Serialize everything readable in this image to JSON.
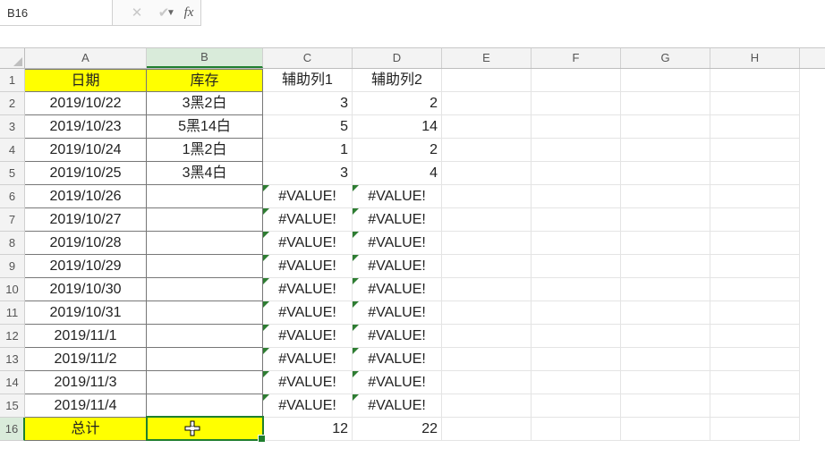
{
  "formula_bar": {
    "name_box_value": "B16",
    "fx_label": "fx",
    "formula_value": ""
  },
  "columns": [
    "A",
    "B",
    "C",
    "D",
    "E",
    "F",
    "G",
    "H"
  ],
  "selected_col_index": 1,
  "selected_row_index": 15,
  "header_row": {
    "A": "日期",
    "B": "库存",
    "C": "辅助列1",
    "D": "辅助列2"
  },
  "rows": [
    {
      "n": 1,
      "A": "日期",
      "B": "库存",
      "C": "辅助列1",
      "D": "辅助列2",
      "hdr": true
    },
    {
      "n": 2,
      "A": "2019/10/22",
      "B": "3黑2白",
      "C": "3",
      "D": "2"
    },
    {
      "n": 3,
      "A": "2019/10/23",
      "B": "5黑14白",
      "C": "5",
      "D": "14"
    },
    {
      "n": 4,
      "A": "2019/10/24",
      "B": "1黑2白",
      "C": "1",
      "D": "2"
    },
    {
      "n": 5,
      "A": "2019/10/25",
      "B": "3黑4白",
      "C": "3",
      "D": "4"
    },
    {
      "n": 6,
      "A": "2019/10/26",
      "B": "",
      "C": "#VALUE!",
      "D": "#VALUE!",
      "err": true
    },
    {
      "n": 7,
      "A": "2019/10/27",
      "B": "",
      "C": "#VALUE!",
      "D": "#VALUE!",
      "err": true
    },
    {
      "n": 8,
      "A": "2019/10/28",
      "B": "",
      "C": "#VALUE!",
      "D": "#VALUE!",
      "err": true
    },
    {
      "n": 9,
      "A": "2019/10/29",
      "B": "",
      "C": "#VALUE!",
      "D": "#VALUE!",
      "err": true
    },
    {
      "n": 10,
      "A": "2019/10/30",
      "B": "",
      "C": "#VALUE!",
      "D": "#VALUE!",
      "err": true
    },
    {
      "n": 11,
      "A": "2019/10/31",
      "B": "",
      "C": "#VALUE!",
      "D": "#VALUE!",
      "err": true
    },
    {
      "n": 12,
      "A": "2019/11/1",
      "B": "",
      "C": "#VALUE!",
      "D": "#VALUE!",
      "err": true
    },
    {
      "n": 13,
      "A": "2019/11/2",
      "B": "",
      "C": "#VALUE!",
      "D": "#VALUE!",
      "err": true
    },
    {
      "n": 14,
      "A": "2019/11/3",
      "B": "",
      "C": "#VALUE!",
      "D": "#VALUE!",
      "err": true
    },
    {
      "n": 15,
      "A": "2019/11/4",
      "B": "",
      "C": "#VALUE!",
      "D": "#VALUE!",
      "err": true
    },
    {
      "n": 16,
      "A": "总计",
      "B": "",
      "C": "12",
      "D": "22",
      "total": true
    }
  ],
  "chart_data": {
    "type": "table",
    "title": "",
    "columns": [
      "日期",
      "库存",
      "辅助列1",
      "辅助列2"
    ],
    "rows": [
      [
        "2019/10/22",
        "3黑2白",
        3,
        2
      ],
      [
        "2019/10/23",
        "5黑14白",
        5,
        14
      ],
      [
        "2019/10/24",
        "1黑2白",
        1,
        2
      ],
      [
        "2019/10/25",
        "3黑4白",
        3,
        4
      ],
      [
        "2019/10/26",
        "",
        "#VALUE!",
        "#VALUE!"
      ],
      [
        "2019/10/27",
        "",
        "#VALUE!",
        "#VALUE!"
      ],
      [
        "2019/10/28",
        "",
        "#VALUE!",
        "#VALUE!"
      ],
      [
        "2019/10/29",
        "",
        "#VALUE!",
        "#VALUE!"
      ],
      [
        "2019/10/30",
        "",
        "#VALUE!",
        "#VALUE!"
      ],
      [
        "2019/10/31",
        "",
        "#VALUE!",
        "#VALUE!"
      ],
      [
        "2019/11/1",
        "",
        "#VALUE!",
        "#VALUE!"
      ],
      [
        "2019/11/2",
        "",
        "#VALUE!",
        "#VALUE!"
      ],
      [
        "2019/11/3",
        "",
        "#VALUE!",
        "#VALUE!"
      ],
      [
        "2019/11/4",
        "",
        "#VALUE!",
        "#VALUE!"
      ],
      [
        "总计",
        "",
        12,
        22
      ]
    ]
  }
}
